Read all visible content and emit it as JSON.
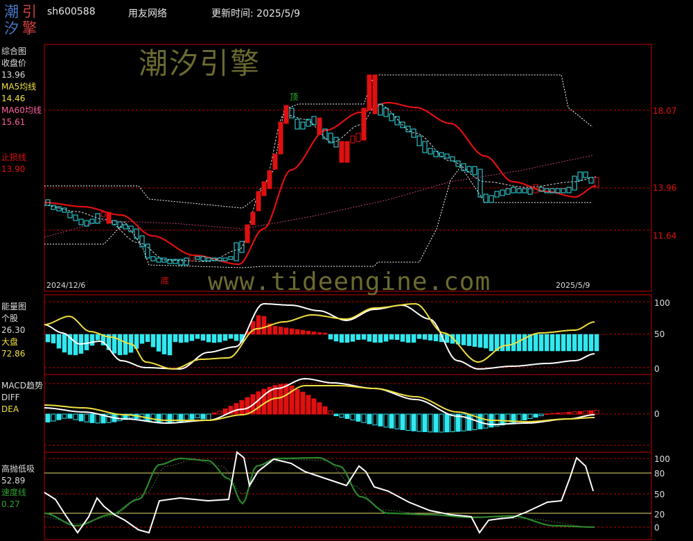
{
  "logo": {
    "c1": "潮",
    "c2": "引",
    "c3": "汐",
    "c4": "擎"
  },
  "header": {
    "code": "sh600588",
    "name": "用友网络",
    "update": "更新时间: 2025/5/9"
  },
  "watermark": "潮汐引擎",
  "url": "www.tideengine.com",
  "panel1": {
    "title": "综合图",
    "close_label": "收盘价",
    "close_value": "13.96",
    "ma5_label": "MA5均线",
    "ma5_value": "14.46",
    "ma60_label": "MA60均线",
    "ma60_value": "15.61",
    "stop_label": "止损线",
    "stop_value": "13.90",
    "axis": [
      "18.07",
      "13.96",
      "11.64"
    ],
    "date_start": "2024/12/6",
    "date_end": "2025/5/9",
    "mark_top": "顶",
    "mark_bottom": "底"
  },
  "panel2": {
    "title": "能量图",
    "stock_label": "个股",
    "stock_value": "26.30",
    "market_label": "大盘",
    "market_value": "72.86",
    "axis": [
      "100",
      "50",
      "0"
    ]
  },
  "panel3": {
    "title": "MACD趋势",
    "diff_label": "DIFF",
    "dea_label": "DEA",
    "axis": [
      "0"
    ]
  },
  "panel4": {
    "title": "高抛低吸",
    "value": "52.89",
    "speed_label": "速度线",
    "speed_value": "0.27",
    "axis": [
      "100",
      "80",
      "50",
      "20",
      "0"
    ]
  },
  "colors": {
    "red": "#e01010",
    "cyan": "#30e8f0",
    "yellow": "#f0e040",
    "white": "#ffffff",
    "green": "#2a8a2a",
    "pink": "#ff60a0",
    "border": "#c00000"
  }
}
